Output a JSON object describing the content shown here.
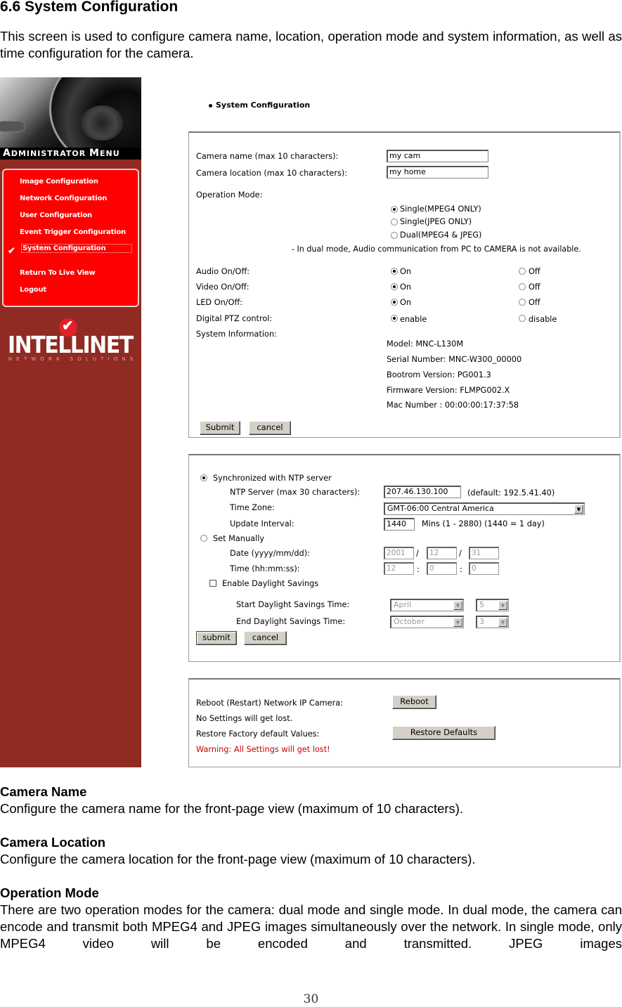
{
  "document": {
    "heading": "6.6 System Configuration",
    "intro": "This screen is used to configure camera name, location, operation mode and system information, as well as time configuration for the camera.",
    "sections": [
      {
        "title": "Camera Name",
        "body": "Configure the camera name for the front-page view (maximum of 10 characters)."
      },
      {
        "title": "Camera Location",
        "body": "Configure the camera location for the front-page view (maximum of 10 characters)."
      },
      {
        "title": "Operation Mode",
        "body": "There are two operation modes for the camera: dual mode and single mode. In dual mode, the camera can encode and transmit both MPEG4 and JPEG images simultaneously over the network. In single mode, only MPEG4 video will be encoded and transmitted. JPEG images"
      }
    ],
    "page_number": "30"
  },
  "sidebar": {
    "menu_title_first_big": "A",
    "menu_title_first_rest": "DMINISTRATOR ",
    "menu_title_second_big": "M",
    "menu_title_second_rest": "ENU",
    "items": [
      {
        "label": "Image Configuration"
      },
      {
        "label": "Network Configuration"
      },
      {
        "label": "User Configuration"
      },
      {
        "label": "Event Trigger Configuration"
      },
      {
        "label": "System Configuration",
        "active": true
      },
      {
        "label": "Return To Live View"
      },
      {
        "label": "Logout"
      }
    ],
    "check_icon": "✔",
    "logo_text": "INTELLINET",
    "logo_tagline": "NETWORK SOLUTIONS",
    "logo_tick": "✔"
  },
  "content": {
    "title": "System Configuration",
    "general": {
      "camera_name_label": "Camera name (max 10 characters):",
      "camera_name_value": "my cam",
      "camera_location_label": "Camera location (max 10 characters):",
      "camera_location_value": "my home",
      "operation_mode_label": "Operation Mode:",
      "operation_modes": [
        {
          "label": "Single(MPEG4 ONLY)",
          "selected": true
        },
        {
          "label": "Single(JPEG ONLY)",
          "selected": false
        },
        {
          "label": "Dual(MPEG4 & JPEG)",
          "selected": false
        }
      ],
      "dual_mode_note": "- In dual mode, Audio communication from PC to CAMERA is not available.",
      "toggles": [
        {
          "label": "Audio On/Off:",
          "on_label": "On",
          "off_label": "Off",
          "value": "On"
        },
        {
          "label": "Video On/Off:",
          "on_label": "On",
          "off_label": "Off",
          "value": "On"
        },
        {
          "label": "LED On/Off:",
          "on_label": "On",
          "off_label": "Off",
          "value": "On"
        },
        {
          "label": "Digital PTZ control:",
          "on_label": "enable",
          "off_label": "disable",
          "value": "enable"
        }
      ],
      "system_info_label": "System Information:",
      "system_info": [
        "Model: MNC-L130M",
        "Serial Number: MNC-W300_00000",
        "Bootrom Version: PG001.3",
        "Firmware Version: FLMPG002.X",
        "Mac Number : 00:00:00:17:37:58"
      ],
      "submit_label": "Submit",
      "cancel_label": "cancel"
    },
    "time": {
      "ntp_option_label": "Synchronized with NTP server",
      "ntp_selected": true,
      "ntp_server_label": "NTP Server (max 30 characters):",
      "ntp_server_value": "207.46.130.100",
      "ntp_default_note": "(default: 192.5.41.40)",
      "time_zone_label": "Time Zone:",
      "time_zone_value": "GMT-06:00 Central America",
      "update_interval_label": "Update Interval:",
      "update_interval_value": "1440",
      "update_interval_note": "Mins (1 - 2880) (1440 = 1 day)",
      "manual_option_label": "Set Manually",
      "manual_selected": false,
      "date_label": "Date (yyyy/mm/dd):",
      "date_year": "2001",
      "date_month": "12",
      "date_day": "31",
      "date_sep": "/",
      "time_label": "Time (hh:mm:ss):",
      "time_hour": "12",
      "time_minute": "0",
      "time_second": "0",
      "time_sep": ":",
      "dst_checkbox_label": "Enable Daylight Savings",
      "dst_enabled": false,
      "dst_start_label": "Start Daylight Savings Time:",
      "dst_start_month": "April",
      "dst_start_day": "5",
      "dst_end_label": "End Daylight Savings Time:",
      "dst_end_month": "October",
      "dst_end_day": "3",
      "dropdown_arrow": "▼",
      "submit_label": "submit",
      "cancel_label": "cancel"
    },
    "maintenance": {
      "reboot_label": "Reboot (Restart) Network IP Camera:",
      "reboot_note": "No Settings will get lost.",
      "reboot_button": "Reboot",
      "restore_label": "Restore Factory default Values:",
      "restore_warning": "Warning: All Settings will get lost!",
      "restore_button": "Restore Defaults",
      "warning_color": "#cc0000"
    }
  }
}
